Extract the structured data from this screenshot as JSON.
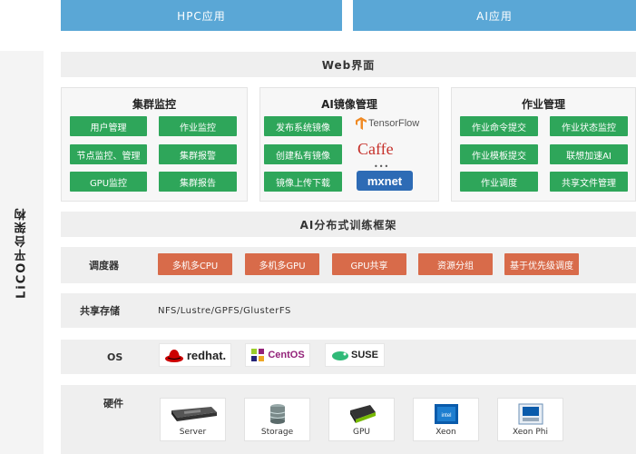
{
  "top": {
    "hpc": "HPC应用",
    "ai": "AI应用"
  },
  "side": {
    "label": "LiCO平台架构"
  },
  "web": {
    "title": "Web界面"
  },
  "cluster": {
    "title": "集群监控",
    "buttons": [
      "用户管理",
      "作业监控",
      "节点监控、管理",
      "集群报警",
      "GPU监控",
      "集群报告"
    ]
  },
  "aimirror": {
    "title": "AI镜像管理",
    "buttons": [
      "发布系统镜像",
      "创建私有镜像",
      "镜像上传下载"
    ],
    "frameworks": [
      "TensorFlow",
      "Caffe",
      "mxnet"
    ]
  },
  "jobs": {
    "title": "作业管理",
    "buttons": [
      "作业命令提交",
      "作业状态监控",
      "作业模板提交",
      "联想加速AI",
      "作业调度",
      "共享文件管理"
    ]
  },
  "aitrain": {
    "title": "AI分布式训练框架"
  },
  "scheduler": {
    "label": "调度器",
    "buttons": [
      "多机多CPU",
      "多机多GPU",
      "GPU共享",
      "资源分组",
      "基于优先级调度"
    ]
  },
  "storage": {
    "label": "共享存储",
    "value": "NFS/Lustre/GPFS/GlusterFS"
  },
  "os": {
    "label": "OS",
    "logos": [
      "redhat.",
      "CentOS",
      "SUSE"
    ]
  },
  "hardware": {
    "label": "硬件",
    "items": [
      "Server",
      "Storage",
      "GPU",
      "Xeon",
      "Xeon Phi"
    ]
  }
}
